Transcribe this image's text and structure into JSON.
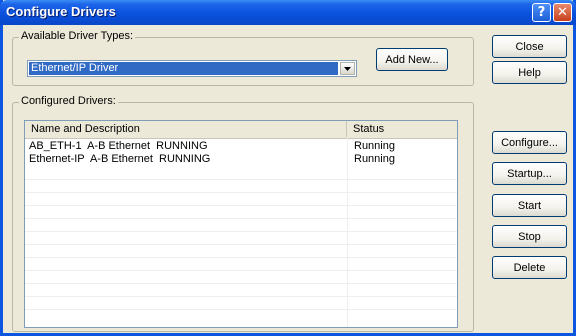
{
  "window": {
    "title": "Configure Drivers",
    "help_glyph": "?",
    "close_glyph": "✕"
  },
  "available": {
    "label": "Available Driver Types:",
    "selected_value": "Ethernet/IP Driver",
    "add_new_label": "Add New..."
  },
  "configured": {
    "label": "Configured Drivers:",
    "columns": [
      "Name and Description",
      "Status"
    ],
    "rows": [
      {
        "name": "AB_ETH-1  A-B Ethernet  RUNNING",
        "status": "Running"
      },
      {
        "name": "Ethernet-IP  A-B Ethernet  RUNNING",
        "status": "Running"
      }
    ]
  },
  "buttons": {
    "close": "Close",
    "help": "Help",
    "configure": "Configure...",
    "startup": "Startup...",
    "start": "Start",
    "stop": "Stop",
    "delete": "Delete"
  },
  "colors": {
    "titlebar": "#0a52de",
    "selection": "#316ac5",
    "dialog_bg": "#ece9d8"
  },
  "icons": {
    "help": "help-icon",
    "close": "close-icon",
    "dropdown": "chevron-down-icon"
  }
}
